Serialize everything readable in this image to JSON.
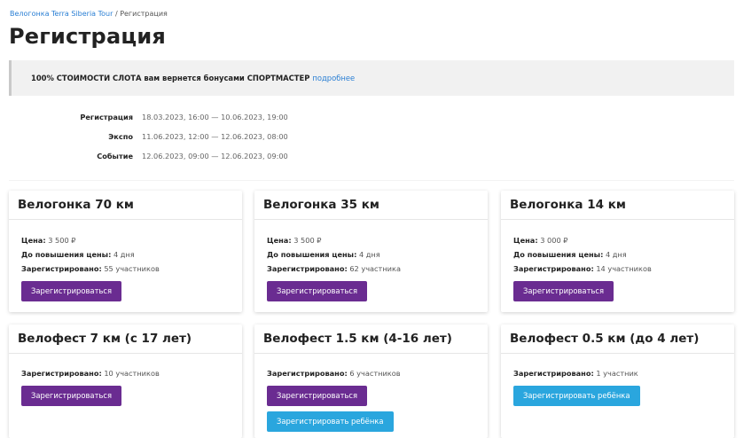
{
  "breadcrumb": {
    "link": "Велогонка Terra Siberia Tour",
    "separator": " / ",
    "current": "Регистрация"
  },
  "page_title": "Регистрация",
  "promo": {
    "bold_text": "100% СТОИМОСТИ СЛОТА вам вернется бонусами СПОРТМАСТЕР",
    "link": "подробнее"
  },
  "dates": [
    {
      "label": "Регистрация",
      "value": "18.03.2023, 16:00 — 10.06.2023, 19:00"
    },
    {
      "label": "Экспо",
      "value": "11.06.2023, 12:00 — 12.06.2023, 08:00"
    },
    {
      "label": "Событие",
      "value": "12.06.2023, 09:00 — 12.06.2023, 09:00"
    }
  ],
  "labels": {
    "price": "Цена:",
    "until_increase": "До повышения цены:",
    "registered": "Зарегистрировано:",
    "register_button": "Зарегистрироваться",
    "register_child_button": "Зарегистрировать ребёнка"
  },
  "cards": [
    {
      "title": "Велогонка 70 км",
      "price": "3 500 ₽",
      "until_increase": "4 дня",
      "registered": "55 участников"
    },
    {
      "title": "Велогонка 35 км",
      "price": "3 500 ₽",
      "until_increase": "4 дня",
      "registered": "62 участника"
    },
    {
      "title": "Велогонка 14 км",
      "price": "3 000 ₽",
      "until_increase": "4 дня",
      "registered": "14 участников"
    },
    {
      "title": "Велофест 7 км (с 17 лет)",
      "registered": "10 участников"
    },
    {
      "title": "Велофест 1.5 км (4-16 лет)",
      "registered": "6 участников"
    },
    {
      "title": "Велофест 0.5 км (до 4 лет)",
      "registered": "1 участник"
    }
  ],
  "colors": {
    "primary_button": "#6a2c91",
    "secondary_button": "#2aa6de",
    "link": "#2a7fd4"
  }
}
